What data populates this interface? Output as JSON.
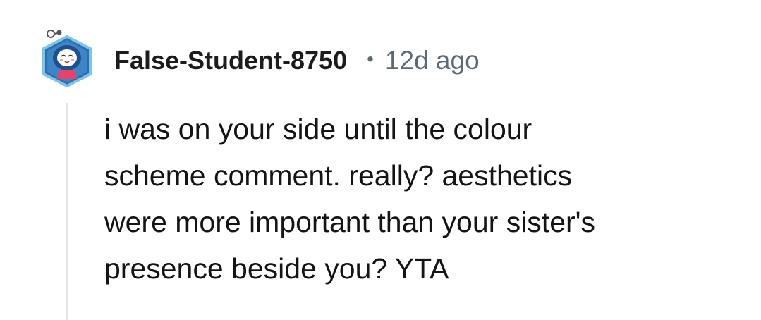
{
  "comment": {
    "author": "False-Student-8750",
    "separator": "•",
    "timestamp": "12d ago",
    "avatar_icon": "snoo-avatar-icon",
    "body_lines": [
      "i was on your side until the colour",
      "scheme comment. really? aesthetics",
      "were more important than your sister's",
      "presence beside you? YTA"
    ]
  },
  "colors": {
    "username": "#1c1c1c",
    "meta": "#5b6b75",
    "body": "#141414",
    "thread_line": "#e3e5e7",
    "avatar_ring": "#3a8fc9",
    "avatar_bg": "#2b6fb0"
  }
}
